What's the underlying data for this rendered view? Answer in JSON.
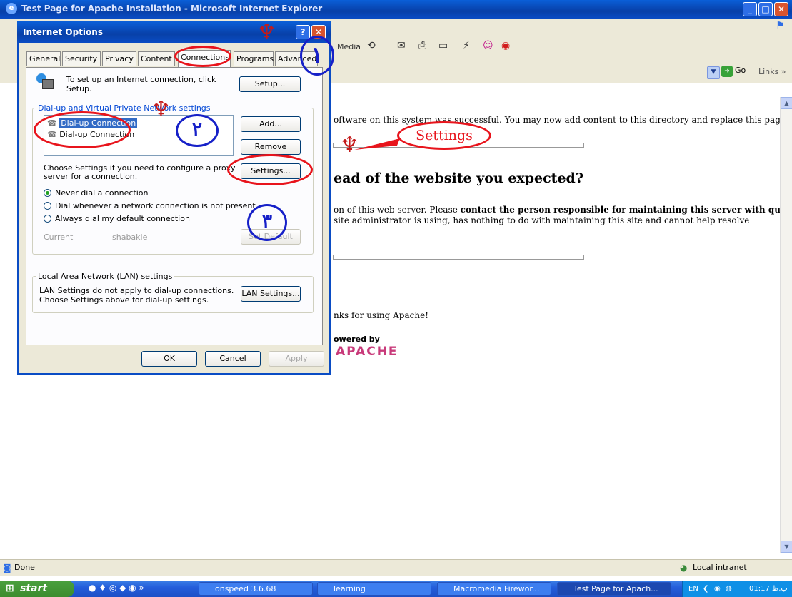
{
  "browser": {
    "title": "Test Page for Apache Installation - Microsoft Internet Explorer",
    "toolbar_media": "Media",
    "go_label": "Go",
    "links_label": "Links",
    "status_left": "Done",
    "status_right": "Local intranet"
  },
  "page": {
    "line1": "oftware on this system was successful. You may now add content to this directory and replace this page.",
    "heading": "ead of the website you expected?",
    "para1_a": "on of this web server. Please ",
    "para1_b": "contact the person responsible for maintaining this server with questions.",
    "para2": "site administrator is using, has nothing to do with maintaining this site and cannot help resolve",
    "thanks": "nks for using Apache!",
    "powered_by": "owered by",
    "apache_logo": "APACHE"
  },
  "dialog": {
    "title": "Internet Options",
    "tabs": [
      "General",
      "Security",
      "Privacy",
      "Content",
      "Connections",
      "Programs",
      "Advanced"
    ],
    "setup_text": "To set up an Internet connection, click Setup.",
    "setup_button": "Setup...",
    "dialup_group": "Dial-up and Virtual Private Network settings",
    "connections": [
      "Dial-up Connection",
      "Dial-up Connection"
    ],
    "add_button": "Add...",
    "remove_button": "Remove",
    "proxy_text_1": "Choose Settings if you need to configure a proxy",
    "proxy_text_2": "server for a connection.",
    "settings_button": "Settings...",
    "radio_never": "Never dial a connection",
    "radio_whenever": "Dial whenever a network connection is not present",
    "radio_always": "Always dial my default connection",
    "current_label": "Current",
    "current_value": "shabakie",
    "set_default_button": "Set Default",
    "lan_group": "Local Area Network (LAN) settings",
    "lan_text_1": "LAN Settings do not apply to dial-up connections.",
    "lan_text_2": "Choose Settings above for dial-up settings.",
    "lan_button": "LAN Settings...",
    "ok_button": "OK",
    "cancel_button": "Cancel",
    "apply_button": "Apply"
  },
  "annotations": {
    "step1": "١",
    "step2": "٢",
    "step3": "٣",
    "callout": "Settings"
  },
  "taskbar": {
    "start_label": "start",
    "tasks": [
      "onspeed 3.6.68",
      "learning",
      "Macromedia Firewor...",
      "Test Page for Apach..."
    ],
    "lang": "EN",
    "clock": "01:17 ب.ظ"
  },
  "colors": {
    "annotation_red": "#e8141c",
    "annotation_blue": "#1620c8",
    "xp_blue": "#0a4cc4"
  }
}
